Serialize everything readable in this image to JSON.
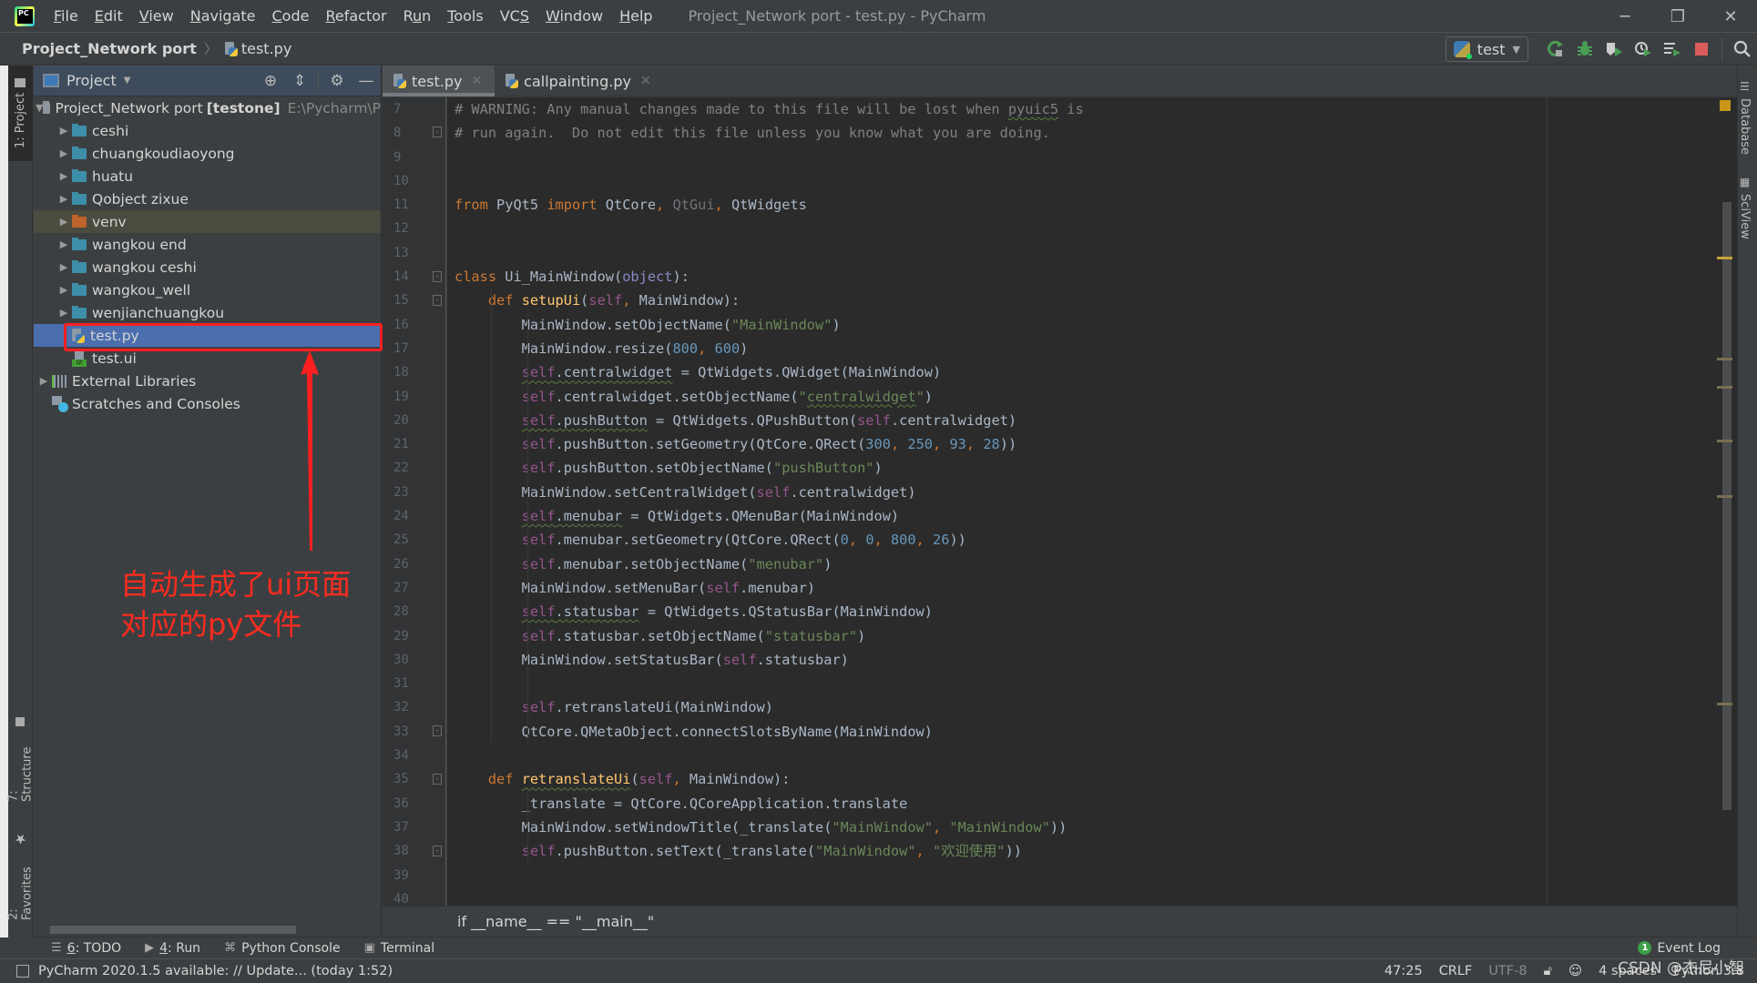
{
  "titlebar": {
    "menu": [
      {
        "mnemonic": "F",
        "rest": "ile"
      },
      {
        "mnemonic": "E",
        "rest": "dit"
      },
      {
        "mnemonic": "V",
        "rest": "iew"
      },
      {
        "mnemonic": "N",
        "rest": "avigate"
      },
      {
        "mnemonic": "C",
        "rest": "ode"
      },
      {
        "mnemonic": "R",
        "rest": "efactor"
      },
      {
        "pre": "R",
        "mnemonic": "u",
        "rest": "n"
      },
      {
        "mnemonic": "T",
        "rest": "ools"
      },
      {
        "pre": "VC",
        "mnemonic": "S",
        "rest": ""
      },
      {
        "mnemonic": "W",
        "rest": "indow"
      },
      {
        "mnemonic": "H",
        "rest": "elp"
      }
    ],
    "window_title": "Project_Network port - test.py - PyCharm",
    "controls": {
      "minimize": "─",
      "restore": "❐",
      "close": "✕"
    }
  },
  "navbar": {
    "project": "Project_Network port",
    "separator": "〉",
    "file": "test.py",
    "run_config": "test",
    "toolbar_icons": [
      "rerun-icon",
      "debug-icon",
      "coverage-icon",
      "profile-icon",
      "concurrency-icon",
      "stop-icon",
      "search-icon"
    ]
  },
  "left_strip": {
    "project_tab": "1: Project",
    "structure_tab": "7: Structure",
    "favorites_tab": "2: Favorites"
  },
  "right_strip": {
    "database_tab": "Database",
    "sciview_tab": "SciView"
  },
  "project_panel": {
    "title": "Project",
    "root": {
      "name": "Project_Network port",
      "module": "[testone]",
      "path": "E:\\Pycharm\\P"
    },
    "folders": [
      "ceshi",
      "chuangkoudiaoyong",
      "huatu",
      "Qobject zixue",
      "venv",
      "wangkou end",
      "wangkou  ceshi",
      "wangkou_well",
      "wenjianchuangkou"
    ],
    "files": [
      "test.py",
      "test.ui"
    ],
    "external_libraries": "External Libraries",
    "scratches": "Scratches and Consoles",
    "selected_file": "test.py"
  },
  "annotation": {
    "line1": "自动生成了ui页面",
    "line2": "对应的py文件",
    "color": "#ff2b1f"
  },
  "editor": {
    "tabs": [
      {
        "label": "test.py",
        "active": true
      },
      {
        "label": "callpainting.py",
        "active": false
      }
    ],
    "line_numbers": [
      "7",
      "8",
      "9",
      "10",
      "11",
      "12",
      "13",
      "14",
      "15",
      "16",
      "17",
      "18",
      "19",
      "20",
      "21",
      "22",
      "23",
      "24",
      "25",
      "26",
      "27",
      "28",
      "29",
      "30",
      "31",
      "32",
      "33",
      "34",
      "35",
      "36",
      "37",
      "38",
      "39",
      "40"
    ],
    "code_lines": [
      "# WARNING: Any manual changes made to this file will be lost when pyuic5 is",
      "# run again.  Do not edit this file unless you know what you are doing.",
      "",
      "",
      "from PyQt5 import QtCore, QtGui, QtWidgets",
      "",
      "",
      "class Ui_MainWindow(object):",
      "    def setupUi(self, MainWindow):",
      "        MainWindow.setObjectName(\"MainWindow\")",
      "        MainWindow.resize(800, 600)",
      "        self.centralwidget = QtWidgets.QWidget(MainWindow)",
      "        self.centralwidget.setObjectName(\"centralwidget\")",
      "        self.pushButton = QtWidgets.QPushButton(self.centralwidget)",
      "        self.pushButton.setGeometry(QtCore.QRect(300, 250, 93, 28))",
      "        self.pushButton.setObjectName(\"pushButton\")",
      "        MainWindow.setCentralWidget(self.centralwidget)",
      "        self.menubar = QtWidgets.QMenuBar(MainWindow)",
      "        self.menubar.setGeometry(QtCore.QRect(0, 0, 800, 26))",
      "        self.menubar.setObjectName(\"menubar\")",
      "        MainWindow.setMenuBar(self.menubar)",
      "        self.statusbar = QtWidgets.QStatusBar(MainWindow)",
      "        self.statusbar.setObjectName(\"statusbar\")",
      "        MainWindow.setStatusBar(self.statusbar)",
      "",
      "        self.retranslateUi(MainWindow)",
      "        QtCore.QMetaObject.connectSlotsByName(MainWindow)",
      "",
      "    def retranslateUi(self, MainWindow):",
      "        _translate = QtCore.QCoreApplication.translate",
      "        MainWindow.setWindowTitle(_translate(\"MainWindow\", \"MainWindow\"))",
      "        self.pushButton.setText(_translate(\"MainWindow\", \"欢迎使用\"))",
      "",
      ""
    ],
    "breadcrumb": "if __name__ == \"__main__\""
  },
  "bottom_tabs": [
    {
      "mnemonic": "6",
      "rest": ": TODO",
      "icon": "todo-icon"
    },
    {
      "mnemonic": "4",
      "rest": ": Run",
      "icon": "run-icon"
    },
    {
      "mnemonic": "",
      "rest": "Python Console",
      "icon": "python-console-icon"
    },
    {
      "mnemonic": "",
      "rest": "Terminal",
      "icon": "terminal-icon"
    }
  ],
  "event_log": {
    "count": "1",
    "label": "Event Log"
  },
  "statusbar": {
    "message": "PyCharm 2020.1.5 available: // Update... (today 1:52)",
    "position": "47:25",
    "line_ending": "CRLF",
    "encoding": "UTF-8",
    "indent": "4 spaces",
    "interpreter": "Python 3.8"
  },
  "watermark": "CSDN @杰尼小智"
}
